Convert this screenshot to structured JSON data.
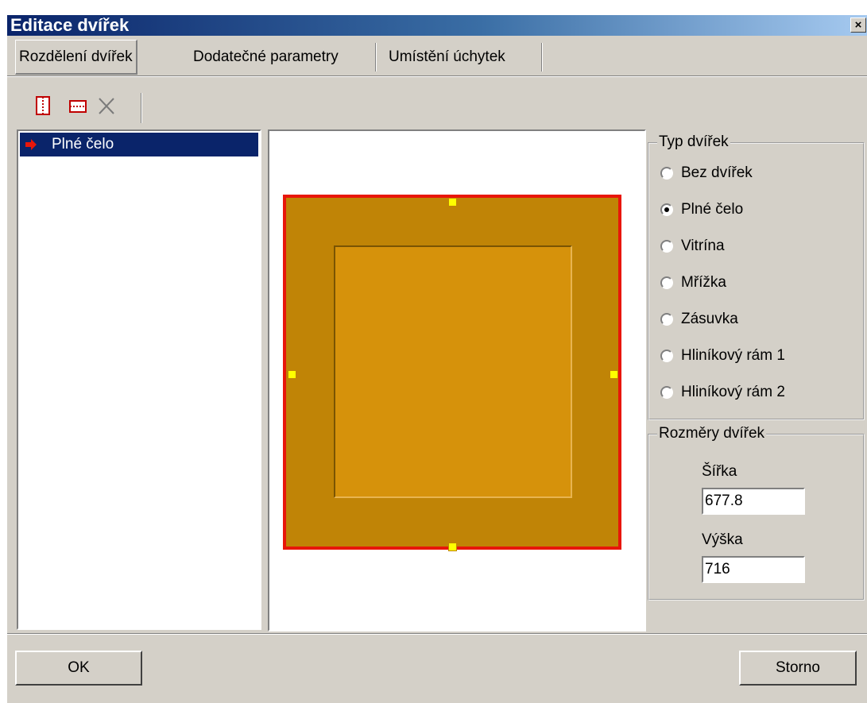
{
  "window": {
    "title": "Editace dvířek",
    "close_glyph": "×"
  },
  "tabs": [
    {
      "label": "Rozdělení dvířek",
      "selected": true
    },
    {
      "label": "Dodatečné parametry",
      "selected": false
    },
    {
      "label": "Umístění úchytek",
      "selected": false
    }
  ],
  "toolbar": {
    "buttons": [
      {
        "icon": "split-vertical-icon"
      },
      {
        "icon": "split-horizontal-icon"
      },
      {
        "icon": "delete-icon"
      }
    ]
  },
  "tree": {
    "items": [
      {
        "label": "Plné čelo",
        "icon": "red-arrow-icon",
        "selected": true
      }
    ]
  },
  "preview": {
    "frame_color": "#c08406",
    "panel_color": "#d6920b",
    "border_color": "#e8160a",
    "handle_color": "#ffff00"
  },
  "door_type": {
    "title": "Typ dvířek",
    "options": [
      {
        "label": "Bez dvířek",
        "checked": false
      },
      {
        "label": "Plné čelo",
        "checked": true
      },
      {
        "label": "Vitrína",
        "checked": false
      },
      {
        "label": "Mřížka",
        "checked": false
      },
      {
        "label": "Zásuvka",
        "checked": false
      },
      {
        "label": "Hliníkový rám 1",
        "checked": false
      },
      {
        "label": "Hliníkový rám 2",
        "checked": false
      }
    ]
  },
  "dimensions": {
    "title": "Rozměry dvířek",
    "width_label": "Šířka",
    "width_value": "677.8",
    "height_label": "Výška",
    "height_value": "716"
  },
  "buttons": {
    "ok": "OK",
    "cancel": "Storno"
  }
}
